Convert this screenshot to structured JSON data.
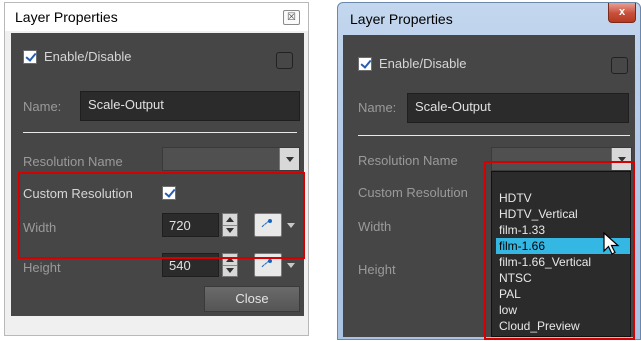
{
  "left_window": {
    "title": "Layer Properties",
    "close_symbol": "☒",
    "enable_label": "Enable/Disable",
    "name_label": "Name:",
    "name_value": "Scale-Output",
    "resolution_name_label": "Resolution Name",
    "resolution_name_value": "",
    "custom_resolution_label": "Custom Resolution",
    "custom_resolution_checked": true,
    "width_label": "Width",
    "width_value": "720",
    "height_label": "Height",
    "height_value": "540",
    "close_button_label": "Close"
  },
  "right_window": {
    "title": "Layer Properties",
    "close_symbol": "x",
    "enable_label": "Enable/Disable",
    "name_label": "Name:",
    "name_value": "Scale-Output",
    "resolution_name_label": "Resolution Name",
    "custom_resolution_label": "Custom Resolution",
    "width_label": "Width",
    "height_label": "Height",
    "dropdown_options": [
      "HDTV",
      "HDTV_Vertical",
      "film-1.33",
      "film-1.66",
      "film-1.66_Vertical",
      "NTSC",
      "PAL",
      "low",
      "Cloud_Preview"
    ],
    "dropdown_selected": "film-1.66"
  },
  "icons": {
    "checkbox": "checkmark-icon",
    "function_curve": "function-curve-icon",
    "mouse_cursor": "mouse-pointer-icon"
  },
  "colors": {
    "panel": "#464646",
    "highlight": "#35b7e4",
    "annotation": "#d60000"
  }
}
